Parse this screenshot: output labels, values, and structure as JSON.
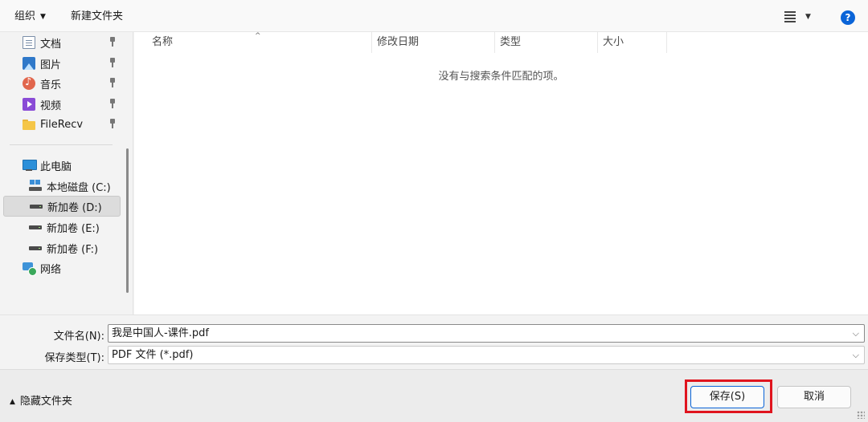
{
  "toolbar": {
    "organize_label": "组织",
    "new_folder_label": "新建文件夹",
    "view_icon": "view-list-icon",
    "help_label": "?"
  },
  "nav": {
    "quick_access": [
      {
        "label": "文档",
        "icon": "documents-icon",
        "pinned": true
      },
      {
        "label": "图片",
        "icon": "pictures-icon",
        "pinned": true
      },
      {
        "label": "音乐",
        "icon": "music-icon",
        "pinned": true
      },
      {
        "label": "视频",
        "icon": "videos-icon",
        "pinned": true
      },
      {
        "label": "FileRecv",
        "icon": "folder-icon",
        "pinned": true
      }
    ],
    "this_pc": {
      "label": "此电脑",
      "icon": "computer-icon"
    },
    "drives": [
      {
        "label": "本地磁盘 (C:)",
        "icon": "system-drive-icon",
        "selected": false
      },
      {
        "label": "新加卷 (D:)",
        "icon": "drive-icon",
        "selected": true
      },
      {
        "label": "新加卷 (E:)",
        "icon": "drive-icon",
        "selected": false
      },
      {
        "label": "新加卷 (F:)",
        "icon": "drive-icon",
        "selected": false
      }
    ],
    "network": {
      "label": "网络",
      "icon": "network-icon"
    }
  },
  "filelist": {
    "columns": [
      "名称",
      "修改日期",
      "类型",
      "大小"
    ],
    "sort_indicator": "^",
    "empty_message": "没有与搜索条件匹配的项。"
  },
  "form": {
    "filename_label": "文件名(N):",
    "filename_value": "我是中国人-课件.pdf",
    "filetype_label": "保存类型(T):",
    "filetype_value": "PDF 文件 (*.pdf)"
  },
  "footer": {
    "hide_folders_label": "隐藏文件夹",
    "save_label": "保存(S)",
    "cancel_label": "取消",
    "highlight_color": "#e0141e"
  }
}
